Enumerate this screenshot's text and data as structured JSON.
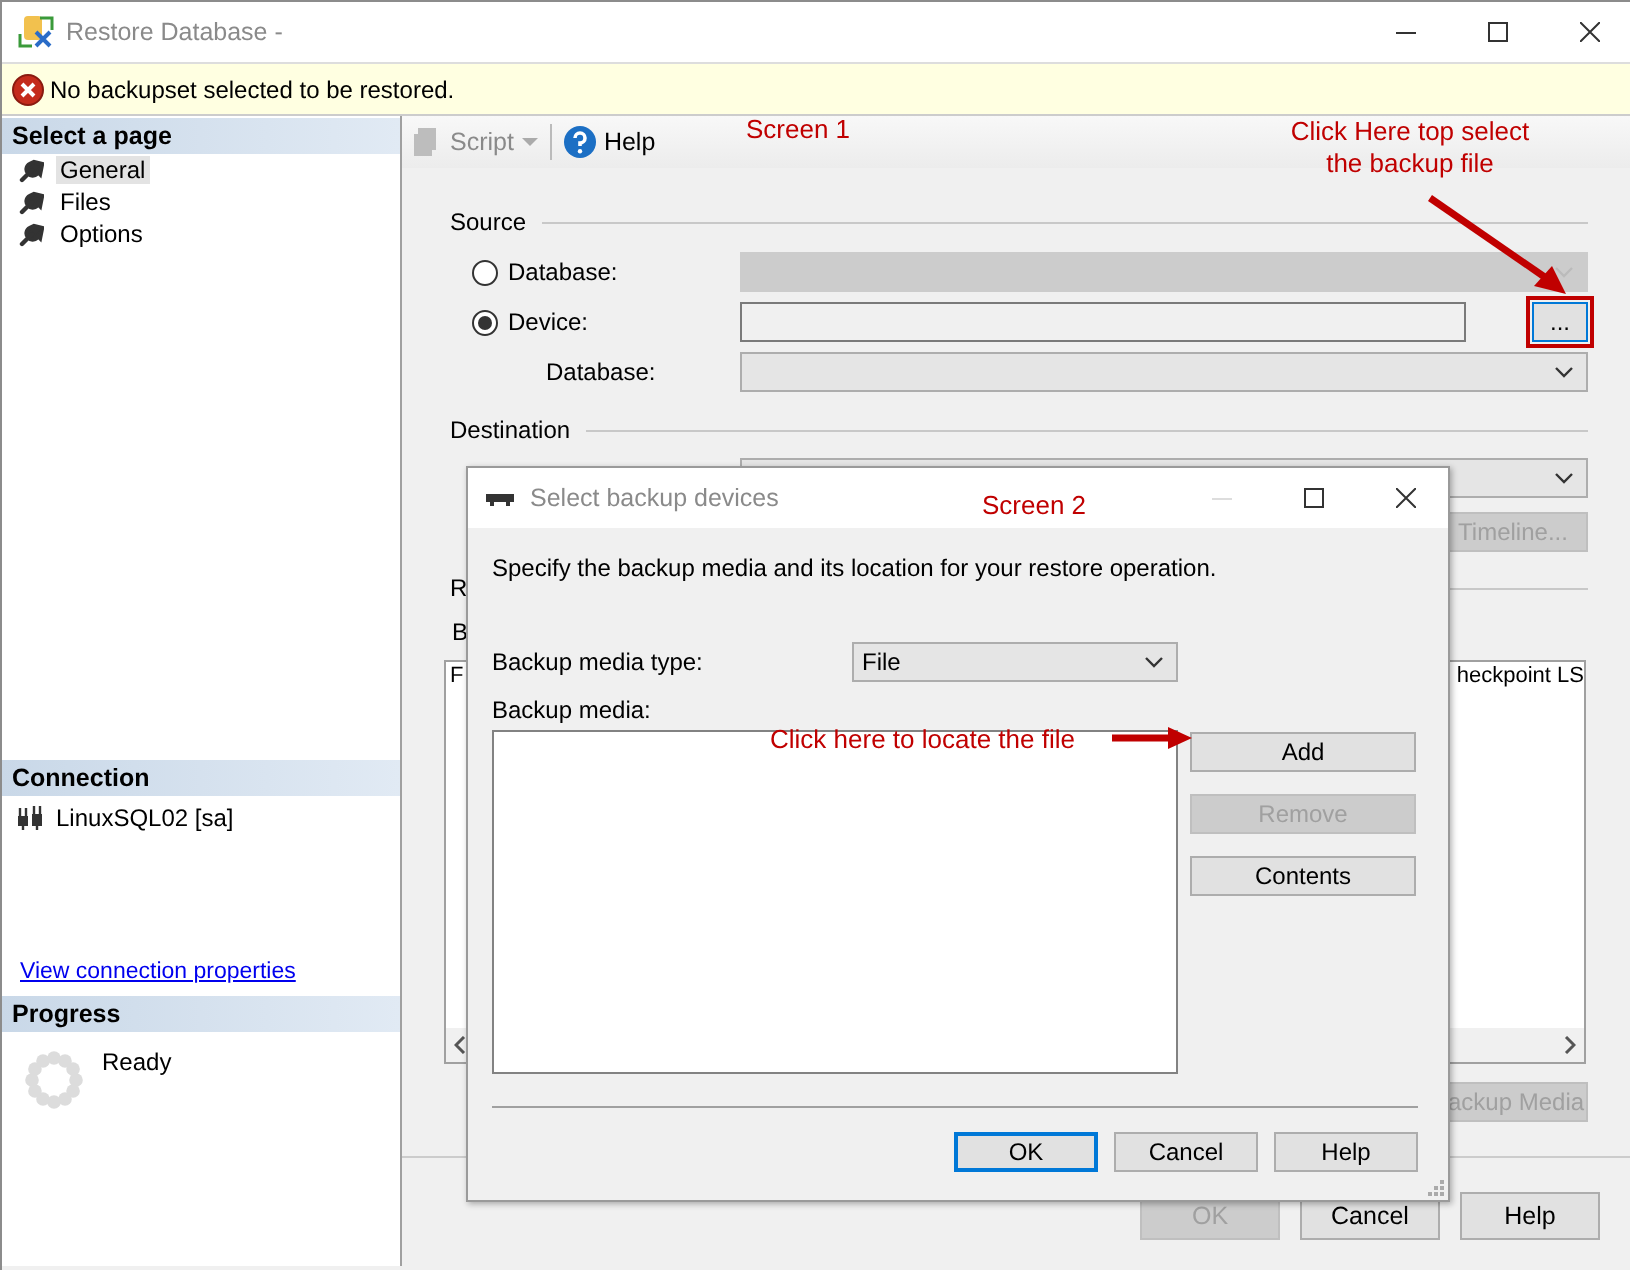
{
  "main_window": {
    "title": "Restore Database -",
    "message": "No backupset selected to be restored.",
    "sidebar": {
      "pages_header": "Select a page",
      "pages": [
        {
          "label": "General",
          "selected": true
        },
        {
          "label": "Files",
          "selected": false
        },
        {
          "label": "Options",
          "selected": false
        }
      ],
      "connection_header": "Connection",
      "connection": "LinuxSQL02 [sa]",
      "connection_link": "View connection properties",
      "progress_header": "Progress",
      "progress_status": "Ready"
    },
    "toolbar": {
      "script": "Script",
      "help": "Help"
    },
    "source": {
      "heading": "Source",
      "rows": [
        {
          "kind": "radiocombo",
          "label": "Database:",
          "selected": false,
          "disabled": true
        },
        {
          "kind": "radiofield",
          "label": "Device:",
          "selected": true,
          "disabled": false,
          "browse": "..."
        },
        {
          "kind": "combo",
          "label": "Database:",
          "disabled": false
        }
      ]
    },
    "destination": {
      "heading": "Destination",
      "timeline_button": {
        "label": "Timeline...",
        "disabled": true
      }
    },
    "restore_plan": {
      "heading": "R",
      "label": "B",
      "grid_columns": [
        "F",
        "heckpoint LS"
      ],
      "media_button": {
        "label": "ackup Media",
        "disabled": true
      }
    },
    "buttons": [
      {
        "label": "OK",
        "disabled": true
      },
      {
        "label": "Cancel",
        "disabled": false
      },
      {
        "label": "Help",
        "disabled": false
      }
    ]
  },
  "dialog": {
    "title": "Select backup devices",
    "description": "Specify the backup media and its location for your restore operation.",
    "media_type_label": "Backup media type:",
    "media_type": "File",
    "media_label": "Backup media:",
    "side_buttons": [
      {
        "label": "Add",
        "disabled": false
      },
      {
        "label": "Remove",
        "disabled": true
      },
      {
        "label": "Contents",
        "disabled": false
      }
    ],
    "buttons": [
      {
        "label": "OK",
        "default": true
      },
      {
        "label": "Cancel",
        "default": false
      },
      {
        "label": "Help",
        "default": false
      }
    ]
  },
  "annotations": [
    {
      "text": "Screen 1"
    },
    {
      "text": "Click Here top select the backup file"
    },
    {
      "text": "Screen 2"
    },
    {
      "text": "Click here to locate the file"
    }
  ]
}
